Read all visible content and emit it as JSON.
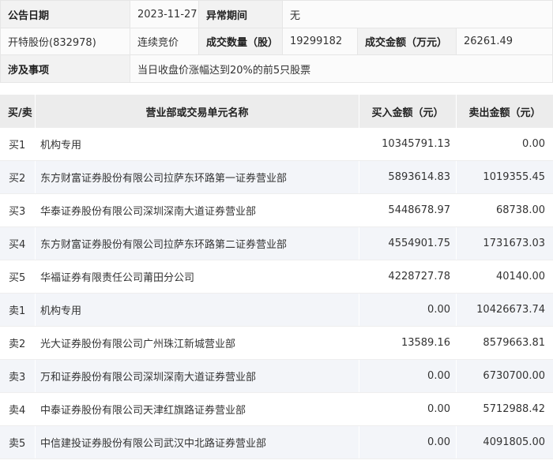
{
  "info": {
    "announce_date_label": "公告日期",
    "announce_date": "2023-11-27",
    "abnormal_period_label": "异常期间",
    "abnormal_period": "无",
    "stock": "开特股份(832978)",
    "trade_method": "连续竞价",
    "volume_label": "成交数量（股）",
    "volume": "19299182",
    "amount_label": "成交金额（万元）",
    "amount": "26261.49",
    "matter_label": "涉及事项",
    "matter": "当日收盘价涨幅达到20%的前5只股票"
  },
  "trades": {
    "headers": {
      "side": "买/卖",
      "name": "营业部或交易单元名称",
      "buy": "买入金额（元）",
      "sell": "卖出金额（元）"
    },
    "rows": [
      {
        "side": "买1",
        "name": "机构专用",
        "buy": "10345791.13",
        "sell": "0.00"
      },
      {
        "side": "买2",
        "name": "东方财富证券股份有限公司拉萨东环路第一证券营业部",
        "buy": "5893614.83",
        "sell": "1019355.45"
      },
      {
        "side": "买3",
        "name": "华泰证券股份有限公司深圳深南大道证券营业部",
        "buy": "5448678.97",
        "sell": "68738.00"
      },
      {
        "side": "买4",
        "name": "东方财富证券股份有限公司拉萨东环路第二证券营业部",
        "buy": "4554901.75",
        "sell": "1731673.03"
      },
      {
        "side": "买5",
        "name": "华福证券有限责任公司莆田分公司",
        "buy": "4228727.78",
        "sell": "40140.00"
      },
      {
        "side": "卖1",
        "name": "机构专用",
        "buy": "0.00",
        "sell": "10426673.74"
      },
      {
        "side": "卖2",
        "name": "光大证券股份有限公司广州珠江新城营业部",
        "buy": "13589.16",
        "sell": "8579663.81"
      },
      {
        "side": "卖3",
        "name": "万和证券股份有限公司深圳深南大道证券营业部",
        "buy": "0.00",
        "sell": "6730700.00"
      },
      {
        "side": "卖4",
        "name": "中泰证券股份有限公司天津红旗路证券营业部",
        "buy": "0.00",
        "sell": "5712988.42"
      },
      {
        "side": "卖5",
        "name": "中信建投证券股份有限公司武汉中北路证券营业部",
        "buy": "0.00",
        "sell": "4091805.00"
      }
    ]
  }
}
